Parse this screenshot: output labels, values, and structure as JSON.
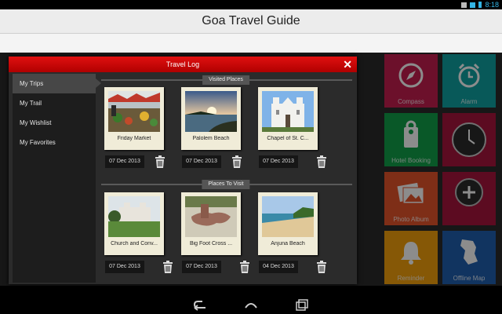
{
  "status": {
    "time": "8:18"
  },
  "app": {
    "title": "Goa Travel Guide"
  },
  "tiles": [
    {
      "label": "Compass",
      "color": "#c51e4f",
      "icon": "compass-icon"
    },
    {
      "label": "Alarm",
      "color": "#10a3a3",
      "icon": "alarm-clock-icon"
    },
    {
      "label": "Hotel Booking",
      "color": "#12a04a",
      "icon": "door-hanger-icon"
    },
    {
      "label": "",
      "color": "#a8143c",
      "icon": "clock-icon"
    },
    {
      "label": "Photo Album",
      "color": "#e6552b",
      "icon": "photo-album-icon"
    },
    {
      "label": "",
      "color": "#a8143c",
      "icon": "add-icon"
    },
    {
      "label": "Reminder",
      "color": "#f5a10c",
      "icon": "bell-icon"
    },
    {
      "label": "Offline Map",
      "color": "#1f5fb0",
      "icon": "map-icon"
    }
  ],
  "dialog": {
    "title": "Travel Log",
    "sidebar": [
      {
        "label": "My Trips",
        "active": true
      },
      {
        "label": "My Trail",
        "active": false
      },
      {
        "label": "My Wishlist",
        "active": false
      },
      {
        "label": "My Favorites",
        "active": false
      }
    ],
    "visited": {
      "heading": "Visited Places",
      "items": [
        {
          "caption": "Friday Market",
          "date": "07 Dec 2013"
        },
        {
          "caption": "Palolem Beach",
          "date": "07 Dec 2013"
        },
        {
          "caption": "Chapel of St. C...",
          "date": "07 Dec 2013"
        }
      ]
    },
    "to_visit": {
      "heading": "Places To Visit",
      "items": [
        {
          "caption": "Church and Conv...",
          "date": "07 Dec 2013"
        },
        {
          "caption": "Big Foot Cross ...",
          "date": "07 Dec 2013"
        },
        {
          "caption": "Anjuna Beach",
          "date": "04 Dec 2013"
        }
      ]
    }
  }
}
